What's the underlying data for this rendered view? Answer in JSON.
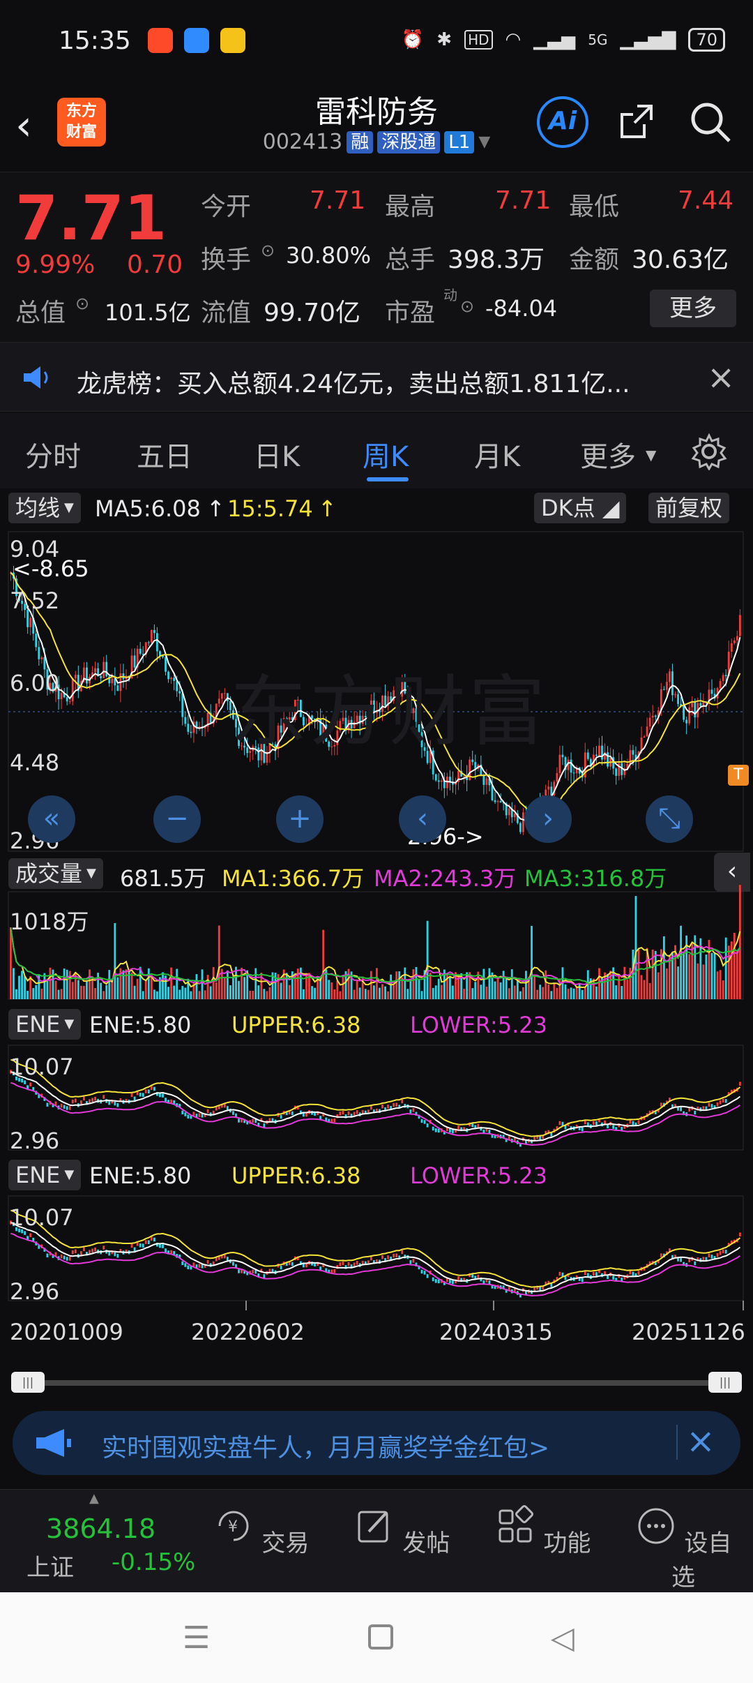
{
  "status_bar": {
    "time": "15:35",
    "battery": "70",
    "network": "5G"
  },
  "header": {
    "back_icon": "chevron-left-icon",
    "logo_text": "东方财富",
    "stock_name": "雷科防务",
    "stock_code": "002413",
    "tags": [
      "融",
      "深股通",
      "L1"
    ],
    "ai_label": "Ai"
  },
  "quote": {
    "price": "7.71",
    "change_pct": "9.99%",
    "change": "0.70",
    "today_open_label": "今开",
    "today_open": "7.71",
    "high_label": "最高",
    "high": "7.71",
    "low_label": "最低",
    "low": "7.44",
    "turnover_label": "换手",
    "turnover": "30.80%",
    "volume_label": "总手",
    "volume": "398.3万",
    "amount_label": "金额",
    "amount": "30.63亿",
    "total_value_label": "总值",
    "total_value": "101.5亿",
    "float_value_label": "流值",
    "float_value": "99.70亿",
    "pe_label": "市盈",
    "pe_sup": "动",
    "pe": "-84.04",
    "more_label": "更多"
  },
  "notice": {
    "text": "龙虎榜：买入总额4.24亿元，卖出总额1.811亿..."
  },
  "tabs": [
    "分时",
    "五日",
    "日K",
    "周K",
    "月K",
    "更多"
  ],
  "active_tab": "周K",
  "main_chart": {
    "indicator": "均线",
    "ma5": "MA5:6.08",
    "ma15": "15:5.74",
    "dk_label": "DK点",
    "adjust_label": "前复权",
    "y_ticks": [
      "9.04",
      "7.52",
      "6.00",
      "4.48",
      "2.96"
    ],
    "max_marker": "<-8.65",
    "min_marker": "2.96->",
    "watermark": "东方财富"
  },
  "volume_chart": {
    "indicator": "成交量",
    "vol": "681.5万",
    "ma1": "MA1:366.7万",
    "ma2": "MA2:243.3万",
    "ma3": "MA3:316.8万",
    "y_max": "1018万"
  },
  "ene_charts": [
    {
      "indicator": "ENE",
      "ene": "ENE:5.80",
      "upper": "UPPER:6.38",
      "lower": "LOWER:5.23",
      "y_max": "10.07",
      "y_min": "2.96"
    },
    {
      "indicator": "ENE",
      "ene": "ENE:5.80",
      "upper": "UPPER:6.38",
      "lower": "LOWER:5.23",
      "y_max": "10.07",
      "y_min": "2.96"
    }
  ],
  "x_axis_dates": [
    "20201009",
    "20220602",
    "20240315",
    "20251126"
  ],
  "promo": {
    "text": "实时围观实盘牛人，月月赢奖学金红包>"
  },
  "bottom_bar": {
    "index_value": "3864.18",
    "index_name": "上证",
    "index_change": "-0.15%",
    "items": [
      "交易",
      "发帖",
      "功能",
      "设自选"
    ]
  },
  "colors": {
    "red": "#f23b3b",
    "green": "#26c13a",
    "yellow": "#f5e23a",
    "magenta": "#e23ad8",
    "cyan": "#2ed4e6",
    "blue": "#3d8bff"
  },
  "chart_data": {
    "type": "candlestick-weekly",
    "x_range": [
      "20201009",
      "20251126"
    ],
    "price_ylim": [
      2.96,
      9.04
    ],
    "close_path_approx": [
      8.65,
      7.6,
      6.3,
      5.9,
      6.3,
      6.5,
      6.2,
      6.7,
      7.3,
      6.4,
      5.1,
      5.4,
      5.8,
      4.9,
      4.6,
      5.0,
      5.7,
      5.3,
      5.0,
      5.4,
      5.6,
      5.9,
      6.2,
      5.0,
      4.2,
      4.0,
      4.4,
      3.7,
      3.2,
      3.1,
      3.6,
      4.5,
      4.3,
      4.8,
      4.2,
      4.6,
      5.5,
      6.3,
      5.5,
      5.9,
      6.08,
      7.71
    ]
  }
}
